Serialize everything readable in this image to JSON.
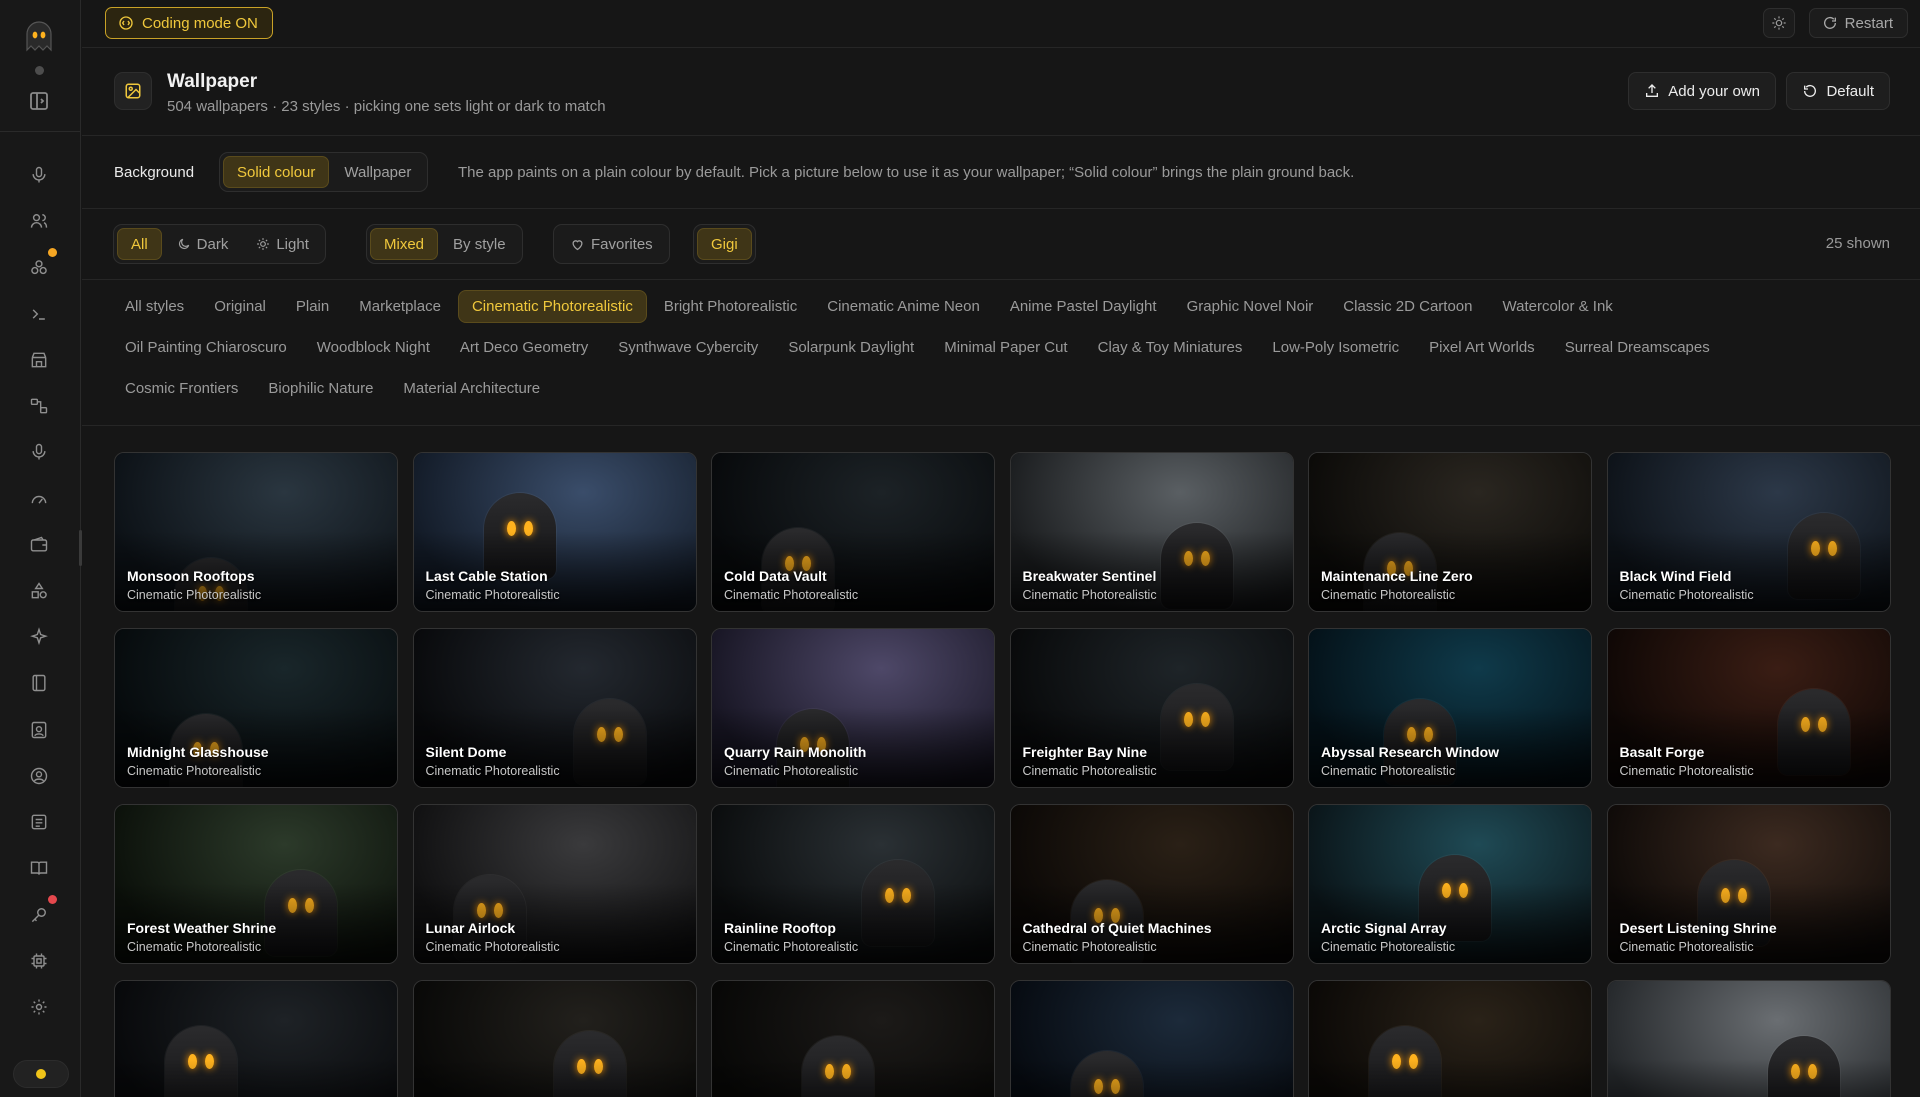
{
  "topbar": {
    "coding_mode": "Coding mode ON",
    "restart": "Restart"
  },
  "header": {
    "title": "Wallpaper",
    "subtitle": "504 wallpapers · 23 styles · picking one sets light or dark to match",
    "add_own": "Add your own",
    "default": "Default"
  },
  "background": {
    "label": "Background",
    "options": [
      "Solid colour",
      "Wallpaper"
    ],
    "selected": "Solid colour",
    "note": "The app paints on a plain colour by default. Pick a picture below to use it as your wallpaper; “Solid colour” brings the plain ground back."
  },
  "filters": {
    "theme": [
      "All",
      "Dark",
      "Light"
    ],
    "theme_selected": "All",
    "grouping": [
      "Mixed",
      "By style"
    ],
    "grouping_selected": "Mixed",
    "favorites": "Favorites",
    "character": "Gigi",
    "shown": "25 shown"
  },
  "styles": {
    "selected": "Cinematic Photorealistic",
    "row1": [
      "All styles",
      "Original",
      "Plain",
      "Marketplace",
      "Cinematic Photorealistic",
      "Bright Photorealistic",
      "Cinematic Anime Neon",
      "Anime Pastel Daylight",
      "Graphic Novel Noir",
      "Classic 2D Cartoon",
      "Watercolor & Ink"
    ],
    "row2": [
      "Oil Painting Chiaroscuro",
      "Woodblock Night",
      "Art Deco Geometry",
      "Synthwave Cybercity",
      "Solarpunk Daylight",
      "Minimal Paper Cut",
      "Clay & Toy Miniatures",
      "Low-Poly Isometric",
      "Pixel Art Worlds",
      "Surreal Dreamscapes"
    ],
    "row3": [
      "Cosmic Frontiers",
      "Biophilic Nature",
      "Material Architecture"
    ]
  },
  "colors": {
    "accent": "#f0c83c",
    "accent_bg": "#3f3517",
    "background": "#161616",
    "badge_orange": "#f5a623",
    "badge_red": "#e5484d"
  },
  "rail_icons": [
    "mic-icon",
    "users-icon",
    "apps-icon",
    "terminal-icon",
    "store-icon",
    "flow-icon",
    "mic-icon",
    "gauge-icon",
    "wallet-icon",
    "shapes-icon",
    "sparkle-icon",
    "notebook-icon",
    "id-badge-icon",
    "user-circle-icon",
    "list-icon",
    "book-icon",
    "key-icon",
    "chip-icon",
    "gear-icon"
  ],
  "wallpapers": [
    {
      "title": "Monsoon Rooftops",
      "style": "Cinematic Photorealistic"
    },
    {
      "title": "Last Cable Station",
      "style": "Cinematic Photorealistic"
    },
    {
      "title": "Cold Data Vault",
      "style": "Cinematic Photorealistic"
    },
    {
      "title": "Breakwater Sentinel",
      "style": "Cinematic Photorealistic"
    },
    {
      "title": "Maintenance Line Zero",
      "style": "Cinematic Photorealistic"
    },
    {
      "title": "Black Wind Field",
      "style": "Cinematic Photorealistic"
    },
    {
      "title": "Midnight Glasshouse",
      "style": "Cinematic Photorealistic"
    },
    {
      "title": "Silent Dome",
      "style": "Cinematic Photorealistic"
    },
    {
      "title": "Quarry Rain Monolith",
      "style": "Cinematic Photorealistic"
    },
    {
      "title": "Freighter Bay Nine",
      "style": "Cinematic Photorealistic"
    },
    {
      "title": "Abyssal Research Window",
      "style": "Cinematic Photorealistic"
    },
    {
      "title": "Basalt Forge",
      "style": "Cinematic Photorealistic"
    },
    {
      "title": "Forest Weather Shrine",
      "style": "Cinematic Photorealistic"
    },
    {
      "title": "Lunar Airlock",
      "style": "Cinematic Photorealistic"
    },
    {
      "title": "Rainline Rooftop",
      "style": "Cinematic Photorealistic"
    },
    {
      "title": "Cathedral of Quiet Machines",
      "style": "Cinematic Photorealistic"
    },
    {
      "title": "Arctic Signal Array",
      "style": "Cinematic Photorealistic"
    },
    {
      "title": "Desert Listening Shrine",
      "style": "Cinematic Photorealistic"
    },
    {
      "title": "",
      "style": ""
    },
    {
      "title": "",
      "style": ""
    },
    {
      "title": "",
      "style": ""
    },
    {
      "title": "",
      "style": ""
    },
    {
      "title": "",
      "style": ""
    },
    {
      "title": "",
      "style": ""
    }
  ]
}
